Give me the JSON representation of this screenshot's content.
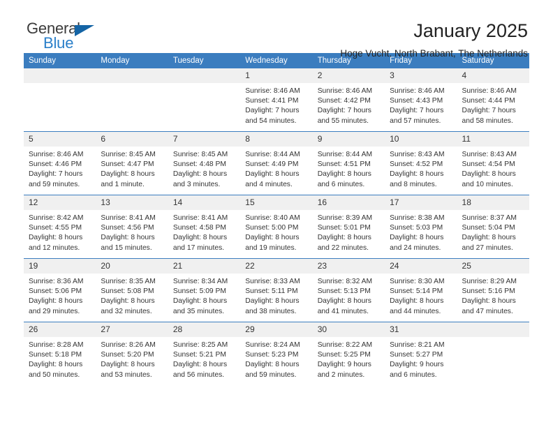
{
  "logo": {
    "word_one": "General",
    "word_two": "Blue",
    "triangle_icon": "blue-triangle-icon",
    "colors": {
      "general": "#3b3b3b",
      "blue": "#2a7fc9",
      "triangle": "#1464a5"
    }
  },
  "header": {
    "title": "January 2025",
    "subtitle": "Hoge Vucht, North Brabant, The Netherlands"
  },
  "theme": {
    "header_bar": "#3b7dbf",
    "daynum_bg": "#f0f0f0",
    "text": "#333333"
  },
  "weekday_headers": [
    "Sunday",
    "Monday",
    "Tuesday",
    "Wednesday",
    "Thursday",
    "Friday",
    "Saturday"
  ],
  "weeks": [
    [
      {
        "day": "",
        "empty": true,
        "sunrise": "",
        "sunset": "",
        "daylight_line1": "",
        "daylight_line2": ""
      },
      {
        "day": "",
        "empty": true,
        "sunrise": "",
        "sunset": "",
        "daylight_line1": "",
        "daylight_line2": ""
      },
      {
        "day": "",
        "empty": true,
        "sunrise": "",
        "sunset": "",
        "daylight_line1": "",
        "daylight_line2": ""
      },
      {
        "day": "1",
        "empty": false,
        "sunrise": "Sunrise: 8:46 AM",
        "sunset": "Sunset: 4:41 PM",
        "daylight_line1": "Daylight: 7 hours",
        "daylight_line2": "and 54 minutes."
      },
      {
        "day": "2",
        "empty": false,
        "sunrise": "Sunrise: 8:46 AM",
        "sunset": "Sunset: 4:42 PM",
        "daylight_line1": "Daylight: 7 hours",
        "daylight_line2": "and 55 minutes."
      },
      {
        "day": "3",
        "empty": false,
        "sunrise": "Sunrise: 8:46 AM",
        "sunset": "Sunset: 4:43 PM",
        "daylight_line1": "Daylight: 7 hours",
        "daylight_line2": "and 57 minutes."
      },
      {
        "day": "4",
        "empty": false,
        "sunrise": "Sunrise: 8:46 AM",
        "sunset": "Sunset: 4:44 PM",
        "daylight_line1": "Daylight: 7 hours",
        "daylight_line2": "and 58 minutes."
      }
    ],
    [
      {
        "day": "5",
        "empty": false,
        "sunrise": "Sunrise: 8:46 AM",
        "sunset": "Sunset: 4:46 PM",
        "daylight_line1": "Daylight: 7 hours",
        "daylight_line2": "and 59 minutes."
      },
      {
        "day": "6",
        "empty": false,
        "sunrise": "Sunrise: 8:45 AM",
        "sunset": "Sunset: 4:47 PM",
        "daylight_line1": "Daylight: 8 hours",
        "daylight_line2": "and 1 minute."
      },
      {
        "day": "7",
        "empty": false,
        "sunrise": "Sunrise: 8:45 AM",
        "sunset": "Sunset: 4:48 PM",
        "daylight_line1": "Daylight: 8 hours",
        "daylight_line2": "and 3 minutes."
      },
      {
        "day": "8",
        "empty": false,
        "sunrise": "Sunrise: 8:44 AM",
        "sunset": "Sunset: 4:49 PM",
        "daylight_line1": "Daylight: 8 hours",
        "daylight_line2": "and 4 minutes."
      },
      {
        "day": "9",
        "empty": false,
        "sunrise": "Sunrise: 8:44 AM",
        "sunset": "Sunset: 4:51 PM",
        "daylight_line1": "Daylight: 8 hours",
        "daylight_line2": "and 6 minutes."
      },
      {
        "day": "10",
        "empty": false,
        "sunrise": "Sunrise: 8:43 AM",
        "sunset": "Sunset: 4:52 PM",
        "daylight_line1": "Daylight: 8 hours",
        "daylight_line2": "and 8 minutes."
      },
      {
        "day": "11",
        "empty": false,
        "sunrise": "Sunrise: 8:43 AM",
        "sunset": "Sunset: 4:54 PM",
        "daylight_line1": "Daylight: 8 hours",
        "daylight_line2": "and 10 minutes."
      }
    ],
    [
      {
        "day": "12",
        "empty": false,
        "sunrise": "Sunrise: 8:42 AM",
        "sunset": "Sunset: 4:55 PM",
        "daylight_line1": "Daylight: 8 hours",
        "daylight_line2": "and 12 minutes."
      },
      {
        "day": "13",
        "empty": false,
        "sunrise": "Sunrise: 8:41 AM",
        "sunset": "Sunset: 4:56 PM",
        "daylight_line1": "Daylight: 8 hours",
        "daylight_line2": "and 15 minutes."
      },
      {
        "day": "14",
        "empty": false,
        "sunrise": "Sunrise: 8:41 AM",
        "sunset": "Sunset: 4:58 PM",
        "daylight_line1": "Daylight: 8 hours",
        "daylight_line2": "and 17 minutes."
      },
      {
        "day": "15",
        "empty": false,
        "sunrise": "Sunrise: 8:40 AM",
        "sunset": "Sunset: 5:00 PM",
        "daylight_line1": "Daylight: 8 hours",
        "daylight_line2": "and 19 minutes."
      },
      {
        "day": "16",
        "empty": false,
        "sunrise": "Sunrise: 8:39 AM",
        "sunset": "Sunset: 5:01 PM",
        "daylight_line1": "Daylight: 8 hours",
        "daylight_line2": "and 22 minutes."
      },
      {
        "day": "17",
        "empty": false,
        "sunrise": "Sunrise: 8:38 AM",
        "sunset": "Sunset: 5:03 PM",
        "daylight_line1": "Daylight: 8 hours",
        "daylight_line2": "and 24 minutes."
      },
      {
        "day": "18",
        "empty": false,
        "sunrise": "Sunrise: 8:37 AM",
        "sunset": "Sunset: 5:04 PM",
        "daylight_line1": "Daylight: 8 hours",
        "daylight_line2": "and 27 minutes."
      }
    ],
    [
      {
        "day": "19",
        "empty": false,
        "sunrise": "Sunrise: 8:36 AM",
        "sunset": "Sunset: 5:06 PM",
        "daylight_line1": "Daylight: 8 hours",
        "daylight_line2": "and 29 minutes."
      },
      {
        "day": "20",
        "empty": false,
        "sunrise": "Sunrise: 8:35 AM",
        "sunset": "Sunset: 5:08 PM",
        "daylight_line1": "Daylight: 8 hours",
        "daylight_line2": "and 32 minutes."
      },
      {
        "day": "21",
        "empty": false,
        "sunrise": "Sunrise: 8:34 AM",
        "sunset": "Sunset: 5:09 PM",
        "daylight_line1": "Daylight: 8 hours",
        "daylight_line2": "and 35 minutes."
      },
      {
        "day": "22",
        "empty": false,
        "sunrise": "Sunrise: 8:33 AM",
        "sunset": "Sunset: 5:11 PM",
        "daylight_line1": "Daylight: 8 hours",
        "daylight_line2": "and 38 minutes."
      },
      {
        "day": "23",
        "empty": false,
        "sunrise": "Sunrise: 8:32 AM",
        "sunset": "Sunset: 5:13 PM",
        "daylight_line1": "Daylight: 8 hours",
        "daylight_line2": "and 41 minutes."
      },
      {
        "day": "24",
        "empty": false,
        "sunrise": "Sunrise: 8:30 AM",
        "sunset": "Sunset: 5:14 PM",
        "daylight_line1": "Daylight: 8 hours",
        "daylight_line2": "and 44 minutes."
      },
      {
        "day": "25",
        "empty": false,
        "sunrise": "Sunrise: 8:29 AM",
        "sunset": "Sunset: 5:16 PM",
        "daylight_line1": "Daylight: 8 hours",
        "daylight_line2": "and 47 minutes."
      }
    ],
    [
      {
        "day": "26",
        "empty": false,
        "sunrise": "Sunrise: 8:28 AM",
        "sunset": "Sunset: 5:18 PM",
        "daylight_line1": "Daylight: 8 hours",
        "daylight_line2": "and 50 minutes."
      },
      {
        "day": "27",
        "empty": false,
        "sunrise": "Sunrise: 8:26 AM",
        "sunset": "Sunset: 5:20 PM",
        "daylight_line1": "Daylight: 8 hours",
        "daylight_line2": "and 53 minutes."
      },
      {
        "day": "28",
        "empty": false,
        "sunrise": "Sunrise: 8:25 AM",
        "sunset": "Sunset: 5:21 PM",
        "daylight_line1": "Daylight: 8 hours",
        "daylight_line2": "and 56 minutes."
      },
      {
        "day": "29",
        "empty": false,
        "sunrise": "Sunrise: 8:24 AM",
        "sunset": "Sunset: 5:23 PM",
        "daylight_line1": "Daylight: 8 hours",
        "daylight_line2": "and 59 minutes."
      },
      {
        "day": "30",
        "empty": false,
        "sunrise": "Sunrise: 8:22 AM",
        "sunset": "Sunset: 5:25 PM",
        "daylight_line1": "Daylight: 9 hours",
        "daylight_line2": "and 2 minutes."
      },
      {
        "day": "31",
        "empty": false,
        "sunrise": "Sunrise: 8:21 AM",
        "sunset": "Sunset: 5:27 PM",
        "daylight_line1": "Daylight: 9 hours",
        "daylight_line2": "and 6 minutes."
      },
      {
        "day": "",
        "empty": true,
        "sunrise": "",
        "sunset": "",
        "daylight_line1": "",
        "daylight_line2": ""
      }
    ]
  ]
}
